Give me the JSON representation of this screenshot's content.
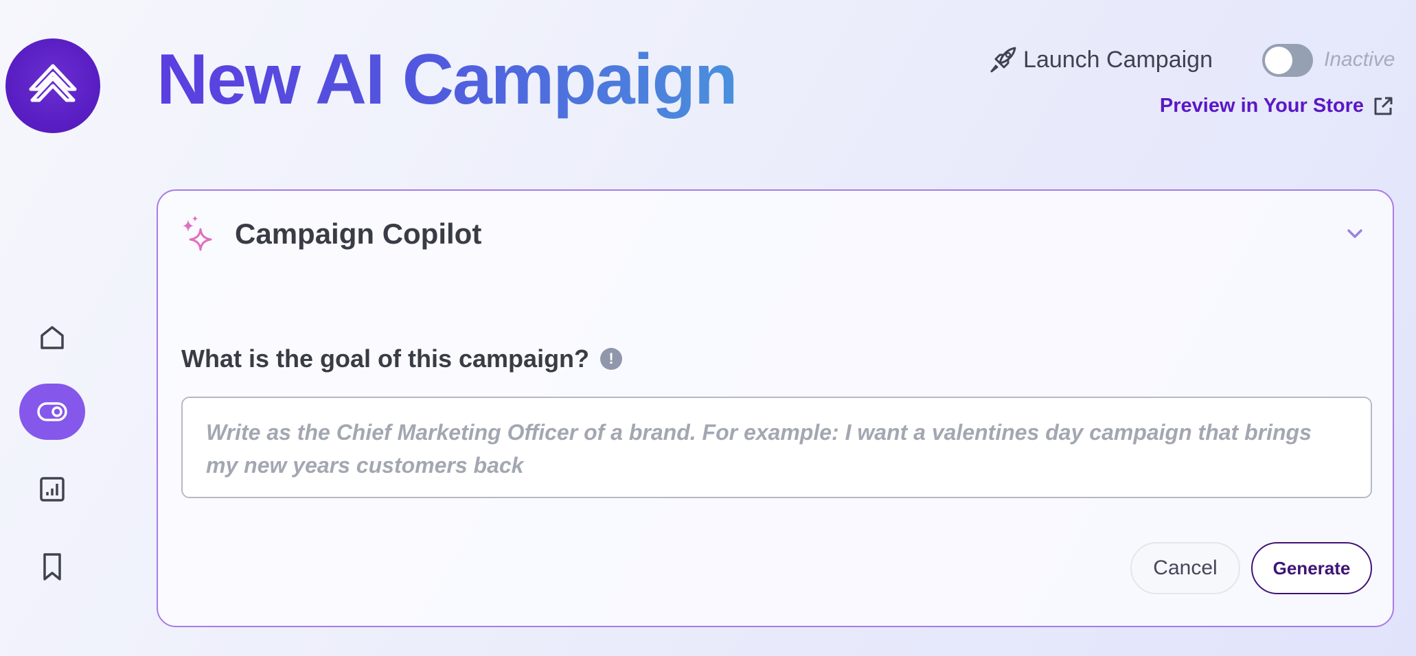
{
  "header": {
    "title": "New AI Campaign",
    "launch_label": "Launch Campaign",
    "status": "Inactive",
    "toggle_on": false,
    "preview_label": "Preview in Your Store"
  },
  "sidebar": {
    "items": [
      {
        "name": "home",
        "icon": "home-icon",
        "active": false
      },
      {
        "name": "campaigns",
        "icon": "toggle-icon",
        "active": true
      },
      {
        "name": "analytics",
        "icon": "chart-icon",
        "active": false
      },
      {
        "name": "saved",
        "icon": "bookmark-icon",
        "active": false
      }
    ]
  },
  "copilot": {
    "title": "Campaign Copilot",
    "question": "What is the goal of this campaign?",
    "info_symbol": "!",
    "placeholder": "Write as the Chief Marketing Officer of a brand. For example: I want a valentines day campaign that brings my new years customers back",
    "value": "",
    "cancel_label": "Cancel",
    "generate_label": "Generate"
  },
  "colors": {
    "brand": "#5a1fc4",
    "accent": "#8557ea",
    "link": "#5a17c6",
    "card_border": "#a77be6",
    "sparkle": "#e06fc0"
  }
}
